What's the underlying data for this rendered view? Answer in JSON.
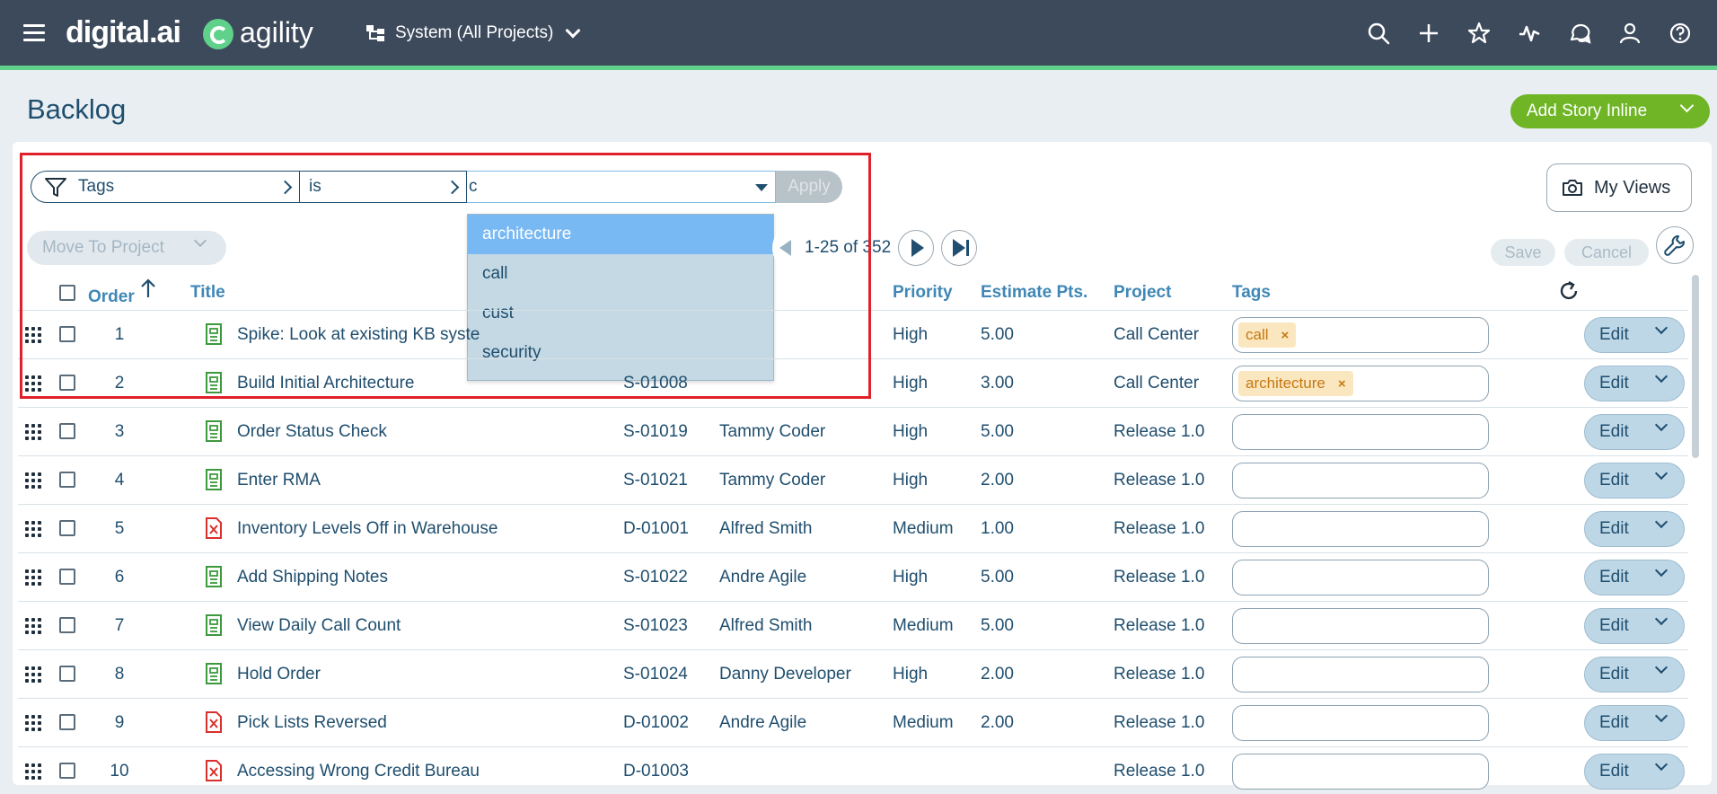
{
  "nav": {
    "logo_digital": "digital.ai",
    "logo_agility": "agility",
    "project_selector": "System (All Projects)",
    "icons": [
      "search-icon",
      "plus-icon",
      "star-icon",
      "activity-icon",
      "conversations-icon",
      "user-icon",
      "help-icon"
    ]
  },
  "page": {
    "title": "Backlog",
    "add_story_label": "Add Story Inline"
  },
  "filter": {
    "field": "Tags",
    "operator": "is",
    "input_value": "c",
    "apply_label": "Apply",
    "dropdown_options": [
      "architecture",
      "call",
      "cust",
      "security"
    ],
    "selected_option": "architecture"
  },
  "toolbar": {
    "my_views_label": "My Views",
    "move_to_project_label": "Move To Project",
    "pagination": "1-25 of 352",
    "save_label": "Save",
    "cancel_label": "Cancel"
  },
  "table": {
    "headers": {
      "order": "Order",
      "title": "Title",
      "priority": "Priority",
      "estimate": "Estimate Pts.",
      "project": "Project",
      "tags": "Tags"
    },
    "edit_label": "Edit",
    "rows": [
      {
        "order": "1",
        "type": "story",
        "title": "Spike: Look at existing KB syste",
        "id": "",
        "owner": "",
        "priority": "High",
        "estimate": "5.00",
        "project": "Call Center",
        "tags": [
          "call"
        ]
      },
      {
        "order": "2",
        "type": "story",
        "title": "Build Initial Architecture",
        "id": "S-01008",
        "owner": "",
        "priority": "High",
        "estimate": "3.00",
        "project": "Call Center",
        "tags": [
          "architecture"
        ]
      },
      {
        "order": "3",
        "type": "story",
        "title": "Order Status Check",
        "id": "S-01019",
        "owner": "Tammy Coder",
        "priority": "High",
        "estimate": "5.00",
        "project": "Release 1.0",
        "tags": []
      },
      {
        "order": "4",
        "type": "story",
        "title": "Enter RMA",
        "id": "S-01021",
        "owner": "Tammy Coder",
        "priority": "High",
        "estimate": "2.00",
        "project": "Release 1.0",
        "tags": []
      },
      {
        "order": "5",
        "type": "defect",
        "title": "Inventory Levels Off in Warehouse",
        "id": "D-01001",
        "owner": "Alfred Smith",
        "priority": "Medium",
        "estimate": "1.00",
        "project": "Release 1.0",
        "tags": []
      },
      {
        "order": "6",
        "type": "story",
        "title": "Add Shipping Notes",
        "id": "S-01022",
        "owner": "Andre Agile",
        "priority": "High",
        "estimate": "5.00",
        "project": "Release 1.0",
        "tags": []
      },
      {
        "order": "7",
        "type": "story",
        "title": "View Daily Call Count",
        "id": "S-01023",
        "owner": "Alfred Smith",
        "priority": "Medium",
        "estimate": "5.00",
        "project": "Release 1.0",
        "tags": []
      },
      {
        "order": "8",
        "type": "story",
        "title": "Hold Order",
        "id": "S-01024",
        "owner": "Danny Developer",
        "priority": "High",
        "estimate": "2.00",
        "project": "Release 1.0",
        "tags": []
      },
      {
        "order": "9",
        "type": "defect",
        "title": "Pick Lists Reversed",
        "id": "D-01002",
        "owner": "Andre Agile",
        "priority": "Medium",
        "estimate": "2.00",
        "project": "Release 1.0",
        "tags": []
      },
      {
        "order": "10",
        "type": "defect",
        "title": "Accessing Wrong Credit Bureau",
        "id": "D-01003",
        "owner": "",
        "priority": "",
        "estimate": "",
        "project": "Release 1.0",
        "tags": []
      }
    ]
  },
  "colors": {
    "nav_bg": "#3d4a5c",
    "accent_green": "#6fb525",
    "link_blue": "#1f4e6e",
    "header_blue": "#3f87b6",
    "tag_bg": "#fbe7bf",
    "tag_text": "#c57812",
    "highlight_red": "#e0202a"
  }
}
